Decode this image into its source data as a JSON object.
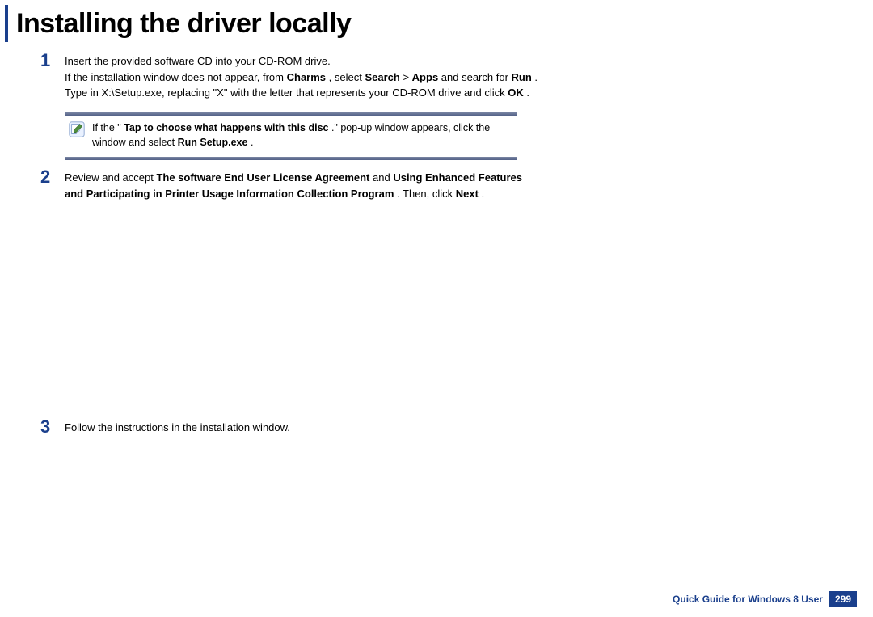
{
  "title": "Installing the driver locally",
  "step1": {
    "text1": "Insert the provided software CD into your CD-ROM drive.",
    "text2_pre": "If the installation window does not appear, from ",
    "charms": "Charms",
    "text2_mid1": ", select ",
    "search": "Search",
    "text2_mid2": " > ",
    "apps": "Apps",
    "text2_mid3": " and search for ",
    "run": "Run",
    "text2_mid4": ". Type in X:\\Setup.exe, replacing \"X\" with the letter that represents your CD-ROM drive and click ",
    "ok": "OK",
    "text2_end": "."
  },
  "note": {
    "line1_pre": "If the \"",
    "line1_bold": "Tap to choose what happens with this disc",
    "line1_post": ".\" pop-up window appears, click the window and select ",
    "line1_run": "Run Setup.exe",
    "line1_end": "."
  },
  "step2": {
    "pre": "Review and accept ",
    "b1": "The software End User License Agreement",
    "mid": " and ",
    "b2": "Using Enhanced Features and Participating in Printer Usage Information Collection Program",
    "post": ". Then, click ",
    "next": "Next",
    "end": "."
  },
  "step3": {
    "text": "Follow the instructions in the installation window."
  },
  "footer": {
    "label": "Quick Guide for Windows 8 User",
    "page": "299"
  }
}
